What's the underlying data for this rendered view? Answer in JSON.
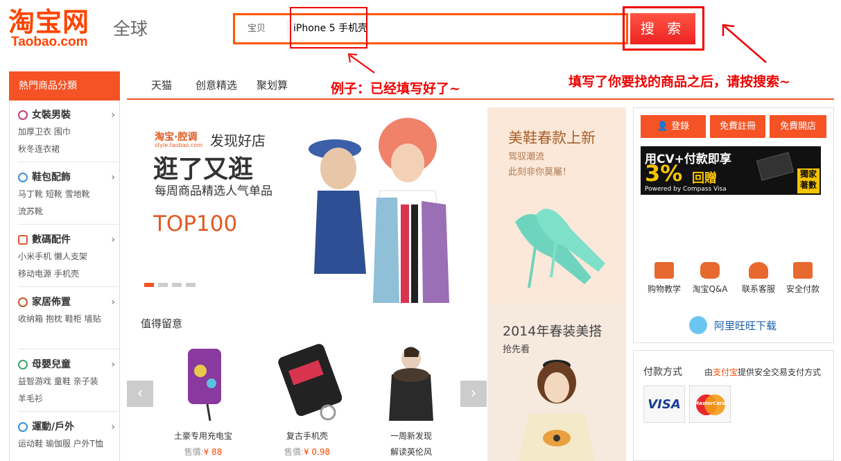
{
  "header": {
    "logo": "淘宝网",
    "logo_sub": "Taobao.com",
    "region": "全球"
  },
  "search": {
    "type_label": "宝贝",
    "value": "iPhone 5 手机壳",
    "button_label": "搜 索"
  },
  "annotations": {
    "example_note": "例子：已经填写好了~",
    "instruction_note": "填写了你要找的商品之后，请按搜索~"
  },
  "nav": {
    "items": [
      "天猫",
      "创意精选",
      "聚划算"
    ]
  },
  "categories": {
    "header": "熱門商品分類",
    "items": [
      {
        "title": "女裝男裝",
        "subs": [
          "加厚卫衣 围巾",
          "秋冬连衣裙"
        ],
        "color": "#c0407a"
      },
      {
        "title": "鞋包配飾",
        "subs": [
          "马丁靴 短靴 雪地靴",
          "流苏靴"
        ],
        "color": "#3a8ed6"
      },
      {
        "title": "數碼配件",
        "subs": [
          "小米手机 懒人支架",
          "移动电源 手机壳"
        ],
        "color": "#e0572a"
      },
      {
        "title": "家居佈置",
        "subs": [
          "收纳箱 抱枕 鞋柜 墙贴"
        ],
        "color": "#c0572a"
      },
      {
        "title": "母嬰兒童",
        "subs": [
          "益智游戏 童鞋 亲子装",
          "羊毛衫"
        ],
        "color": "#3aa66a"
      },
      {
        "title": "運動/戶外",
        "subs": [
          "运动鞋 瑜伽服 户外T恤"
        ],
        "color": "#3a8ed6"
      }
    ]
  },
  "banner": {
    "brand": "淘宝·腔调",
    "brand_url": "style.taobao.com",
    "tagline": "发现好店",
    "headline": "逛了又逛",
    "subline": "每周商品精选人气单品",
    "top": "TOP100"
  },
  "shoe_promo": {
    "title": "美鞋春款上新",
    "line1": "驾驭潮流",
    "line2": "此刻非你莫屬！"
  },
  "spring_promo": {
    "title": "2014年春装美搭",
    "sub": "抢先看"
  },
  "featured": {
    "title": "值得留意",
    "products": [
      {
        "name": "土豪专用充电宝",
        "price_label": "售價:",
        "price": "¥ 88"
      },
      {
        "name": "复古手机壳",
        "price_label": "售價:",
        "price": "¥ 0.98"
      },
      {
        "name": "一周新发现",
        "sub": "解读英伦风"
      }
    ]
  },
  "account": {
    "login": "登錄",
    "register": "免費註冊",
    "open_shop": "免費開店"
  },
  "cv_ad": {
    "line1": "用CV+付款即享",
    "rate": "3%",
    "rebate": "回贈",
    "powered": "Powered by Compass Visa",
    "exclusive": "獨家\n著數"
  },
  "services": [
    {
      "label": "购物教学",
      "icon": "book-icon",
      "color": "#e8692e"
    },
    {
      "label": "淘宝Q&A",
      "icon": "chat-bubble-icon",
      "color": "#e8692e"
    },
    {
      "label": "联系客服",
      "icon": "support-agent-icon",
      "color": "#e8692e"
    },
    {
      "label": "安全付款",
      "icon": "secure-lock-icon",
      "color": "#e8692e"
    }
  ],
  "wangwang": "阿里旺旺下载",
  "payment": {
    "title": "付款方式",
    "provider_prefix": "由",
    "provider": "支付宝",
    "provider_suffix": "提供安全交易支付方式",
    "visa": "VISA",
    "mastercard": "MasterCard"
  }
}
